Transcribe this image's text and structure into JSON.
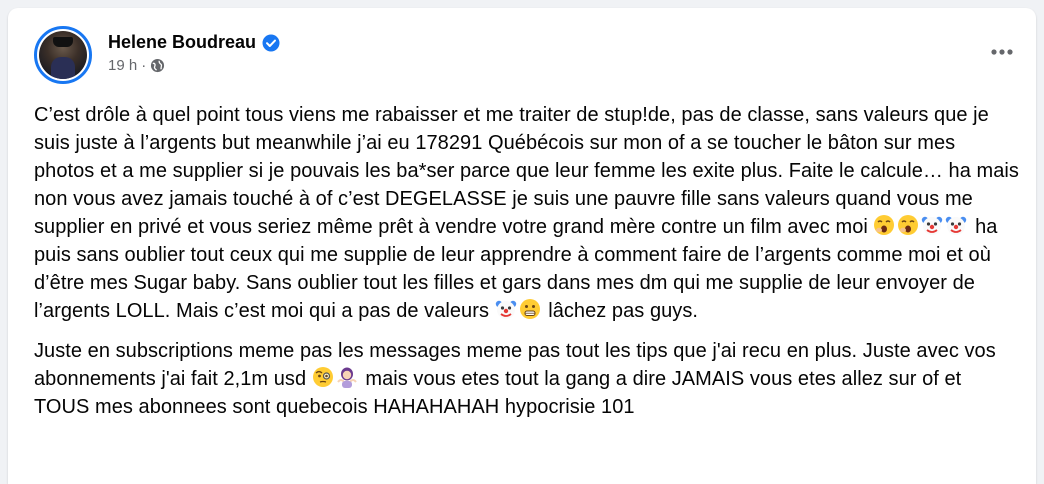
{
  "post": {
    "author_name": "Helene Boudreau",
    "timestamp": "19 h",
    "separator": "·",
    "more_icon": "ellipsis-icon",
    "verified_icon": "verified-badge-icon",
    "audience_icon": "globe-icon",
    "paragraphs": [
      {
        "seg1": "C’est drôle à quel point tous viens me rabaisser et me traiter de stup!de, pas de classe, sans valeurs que je suis juste à l’argents but meanwhile j’ai eu 178291 Québécois sur mon of a se toucher le bâton sur mes photos et a me supplier si je pouvais les ba*ser parce que leur femme les exite plus. Faite le calcule… ha mais non vous avez jamais touché à of c’est DEGELASSE je suis une pauvre fille sans valeurs quand vous me supplier en privé et vous seriez même prêt à vendre votre grand mère contre un film avec moi ",
        "seg2": " ha puis sans oublier tout ceux qui me supplie de leur apprendre à comment faire de l’argents comme moi et où d’être mes Sugar baby. Sans oublier tout les filles et gars dans mes dm qui me supplie de leur envoyer de l’argents LOLL. Mais c’est moi qui a pas de valeurs ",
        "seg3": " lâchez pas guys."
      },
      {
        "seg1": "Juste en subscriptions meme pas les messages meme pas tout les tips que j'ai recu en plus. Juste avec vos abonnements j'ai fait 2,1m usd ",
        "seg2": " mais vous etes tout la gang a dire JAMAIS vous etes allez sur of et TOUS mes abonnees sont quebecois HAHAHAHAH hypocrisie 101"
      }
    ],
    "emoji_groups": {
      "p1_a": [
        "yawning-face-icon",
        "yawning-face-icon",
        "clown-face-icon",
        "clown-face-icon"
      ],
      "p1_b": [
        "clown-face-icon",
        "grimacing-face-icon"
      ],
      "p2_a": [
        "face-with-monocle-icon",
        "woman-shrugging-icon"
      ]
    }
  }
}
